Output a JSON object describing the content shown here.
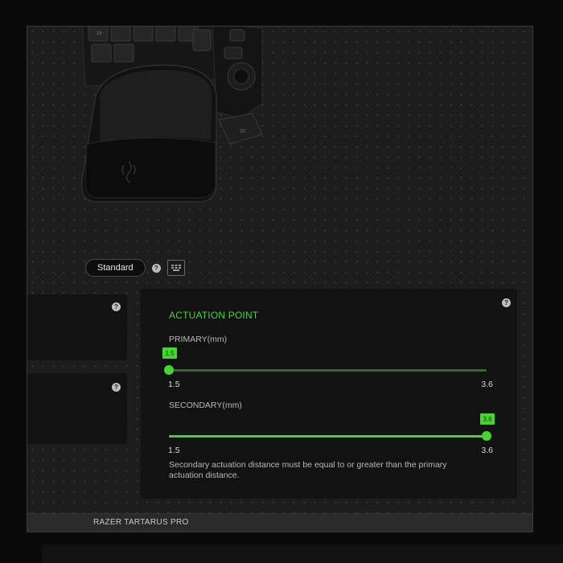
{
  "device": {
    "name": "RAZER TARTARUS PRO",
    "key_labels": [
      "16",
      "20"
    ]
  },
  "mode_selector": {
    "selected": "Standard",
    "help_glyph": "?",
    "icons": [
      "help-icon",
      "keyboard-layout-icon"
    ]
  },
  "side_panels": [
    {
      "help_glyph": "?"
    },
    {
      "help_glyph": "?"
    }
  ],
  "actuation": {
    "title": "ACTUATION POINT",
    "help_glyph": "?",
    "primary": {
      "label": "PRIMARY(mm)",
      "value": "1.5",
      "value_num": 1.5,
      "min": "1.5",
      "max": "3.6",
      "min_num": 1.5,
      "max_num": 3.6
    },
    "secondary": {
      "label": "SECONDARY(mm)",
      "value": "3.6",
      "value_num": 3.6,
      "min": "1.5",
      "max": "3.6",
      "min_num": 1.5,
      "max_num": 3.6
    },
    "note": "Secondary actuation distance must be equal to or greater than the primary actuation distance."
  },
  "footer": {
    "device_name": "RAZER TARTARUS PRO"
  },
  "colors": {
    "accent": "#44d62c",
    "background": "#1d1d1d",
    "panel": "#121212"
  }
}
